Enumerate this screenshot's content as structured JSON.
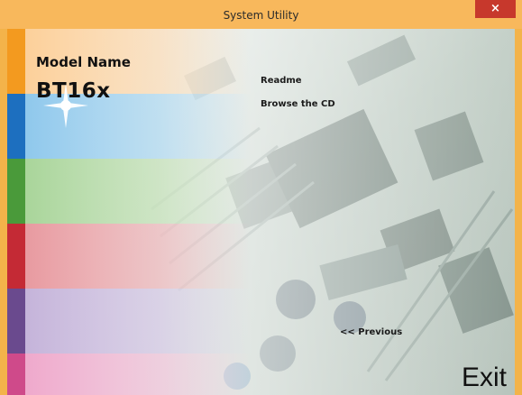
{
  "window": {
    "title": "System Utility",
    "close_label": "×"
  },
  "model": {
    "label": "Model Name",
    "value": "BT16x"
  },
  "menu": {
    "readme": "Readme",
    "browse_cd": "Browse the CD",
    "previous": "<< Previous",
    "exit": "Exit"
  },
  "colors": {
    "titlebar": "#f8b85c",
    "close_button": "#c7382c",
    "stripe_orange": "#f39a1f",
    "stripe_blue": "#1d6fbf",
    "stripe_green": "#4a9a3a",
    "stripe_red": "#c42a35",
    "stripe_purple": "#6a4a8e",
    "stripe_pink": "#cf4a8a"
  }
}
